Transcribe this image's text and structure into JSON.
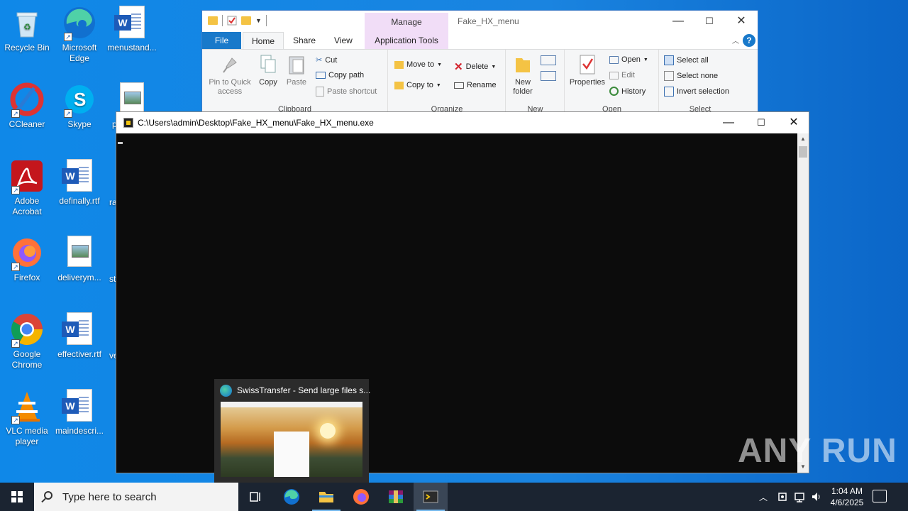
{
  "desktop_icons": [
    {
      "label": "Recycle Bin",
      "icon": "recycle-bin-icon"
    },
    {
      "label": "Microsoft Edge",
      "icon": "edge-icon"
    },
    {
      "label": "menustand...",
      "icon": "word-doc-icon"
    },
    {
      "label": "CCleaner",
      "icon": "ccleaner-icon"
    },
    {
      "label": "Skype",
      "icon": "skype-icon"
    },
    {
      "label": "p",
      "icon": "image-file-icon"
    },
    {
      "label": "Adobe Acrobat",
      "icon": "acrobat-icon"
    },
    {
      "label": "definally.rtf",
      "icon": "word-doc-icon"
    },
    {
      "label": "ra",
      "icon": "partial-icon"
    },
    {
      "label": "Firefox",
      "icon": "firefox-icon"
    },
    {
      "label": "deliverym...",
      "icon": "image-file-icon"
    },
    {
      "label": "st",
      "icon": "partial-icon"
    },
    {
      "label": "Google Chrome",
      "icon": "chrome-icon"
    },
    {
      "label": "effectiver.rtf",
      "icon": "word-doc-icon"
    },
    {
      "label": "ve",
      "icon": "partial-icon"
    },
    {
      "label": "VLC media player",
      "icon": "vlc-icon"
    },
    {
      "label": "maindescri...",
      "icon": "word-doc-icon"
    }
  ],
  "explorer": {
    "title": "Fake_HX_menu",
    "context_tab_header": "Manage",
    "tabs": {
      "file": "File",
      "home": "Home",
      "share": "Share",
      "view": "View",
      "app_tools": "Application Tools"
    },
    "help": "?",
    "clipboard": {
      "pin": "Pin to Quick access",
      "copy": "Copy",
      "paste": "Paste",
      "cut": "Cut",
      "copy_path": "Copy path",
      "paste_shortcut": "Paste shortcut",
      "label": "Clipboard"
    },
    "organize": {
      "move_to": "Move to",
      "copy_to": "Copy to",
      "delete": "Delete",
      "rename": "Rename",
      "label": "Organize"
    },
    "new": {
      "new_folder": "New folder",
      "label": "New"
    },
    "open": {
      "properties": "Properties",
      "open": "Open",
      "edit": "Edit",
      "history": "History",
      "label": "Open"
    },
    "select": {
      "select_all": "Select all",
      "select_none": "Select none",
      "invert": "Invert selection",
      "label": "Select"
    }
  },
  "console": {
    "title": "C:\\Users\\admin\\Desktop\\Fake_HX_menu\\Fake_HX_menu.exe"
  },
  "thumbnail": {
    "title": "SwissTransfer - Send large files s..."
  },
  "taskbar": {
    "search_placeholder": "Type here to search",
    "time": "1:04 AM",
    "date": "4/6/2025"
  },
  "watermark": "ANY RUN",
  "colors": {
    "desktop_bg": "#0f88e8",
    "taskbar_bg": "#1b2431",
    "file_tab": "#1979ca",
    "manage_tab": "#f1ddf7",
    "console_bg": "#0c0c0c"
  }
}
